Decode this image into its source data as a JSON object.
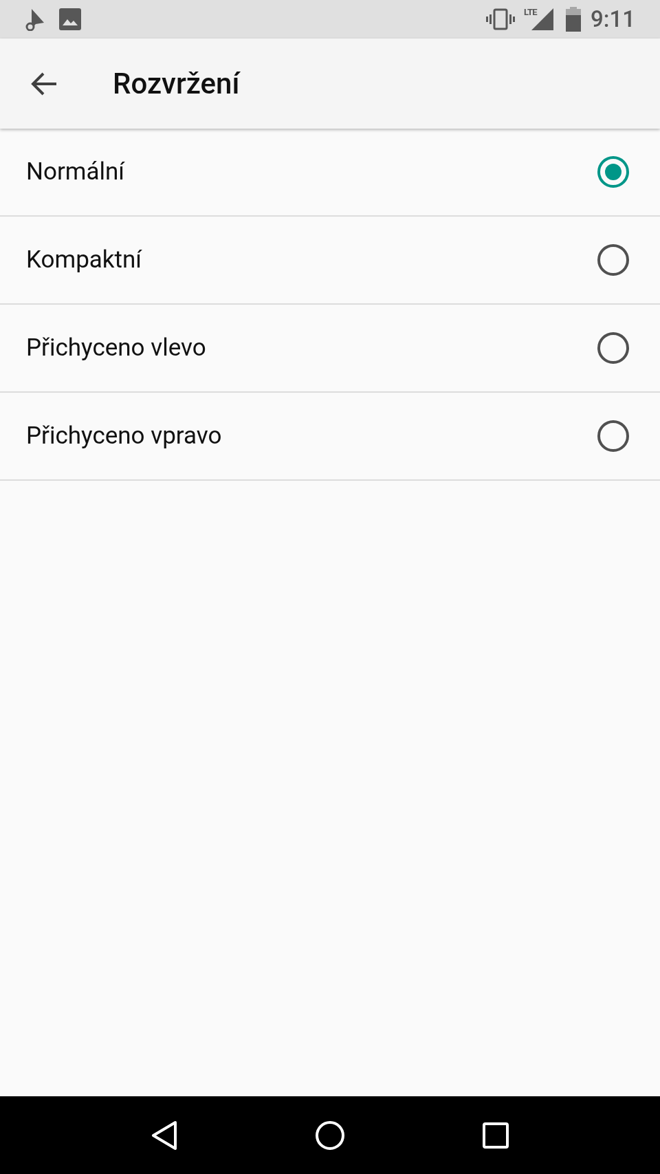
{
  "status_bar": {
    "network": "LTE",
    "time": "9:11"
  },
  "toolbar": {
    "title": "Rozvržení"
  },
  "options": [
    {
      "label": "Normální",
      "selected": true
    },
    {
      "label": "Kompaktní",
      "selected": false
    },
    {
      "label": "Přichyceno vlevo",
      "selected": false
    },
    {
      "label": "Přichyceno vpravo",
      "selected": false
    }
  ]
}
